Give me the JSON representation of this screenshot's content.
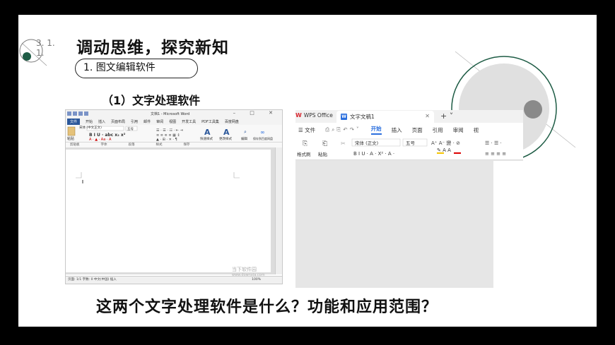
{
  "slide": {
    "number_label": "3. 1.\n1.",
    "title": "调动思维，探究新知",
    "section_pill": "1. 图文编辑软件",
    "subtitle": "（1）文字处理软件",
    "question": "这两个文字处理软件是什么？功能和应用范围？"
  },
  "word_app": {
    "window_title": "文档1 - Microsoft Word",
    "window_controls": "– □ ✕",
    "tabs": [
      "文件",
      "开始",
      "插入",
      "页面布局",
      "引用",
      "邮件",
      "审阅",
      "视图",
      "开发工具",
      "PDF工具集",
      "百度网盘"
    ],
    "font_name": "宋体 (中文正文)",
    "font_size": "五号",
    "style_buttons": [
      "快速样式",
      "更改样式",
      "编辑",
      "保存到百度网盘"
    ],
    "groups": [
      "剪贴板",
      "字体",
      "段落",
      "样式",
      "保存"
    ],
    "paste_label": "粘贴",
    "status": "页面: 1/1   字数: 0   中文(中国)   插入",
    "zoom": "100%"
  },
  "wps_app": {
    "app_tab": "WPS Office",
    "doc_tab": "文字文稿1",
    "menu_file": "☰ 文件",
    "menu_tabs": [
      "开始",
      "插入",
      "页面",
      "引用",
      "审阅",
      "视"
    ],
    "active_tab": "开始",
    "font_name": "宋体 (正文)",
    "font_size": "五号",
    "format_painter": "格式刷",
    "paste": "粘贴"
  },
  "watermark": {
    "text": "当下软件园",
    "url": "www.downxia.com"
  },
  "colors": {
    "frame": "#000000",
    "deco_circle": "#e0e0e0",
    "deco_ring": "#1e5c45",
    "deco_dot": "#8a8a8a",
    "word_blue": "#2b579a",
    "wps_blue": "#2b6fde",
    "wps_red": "#d7262e"
  }
}
